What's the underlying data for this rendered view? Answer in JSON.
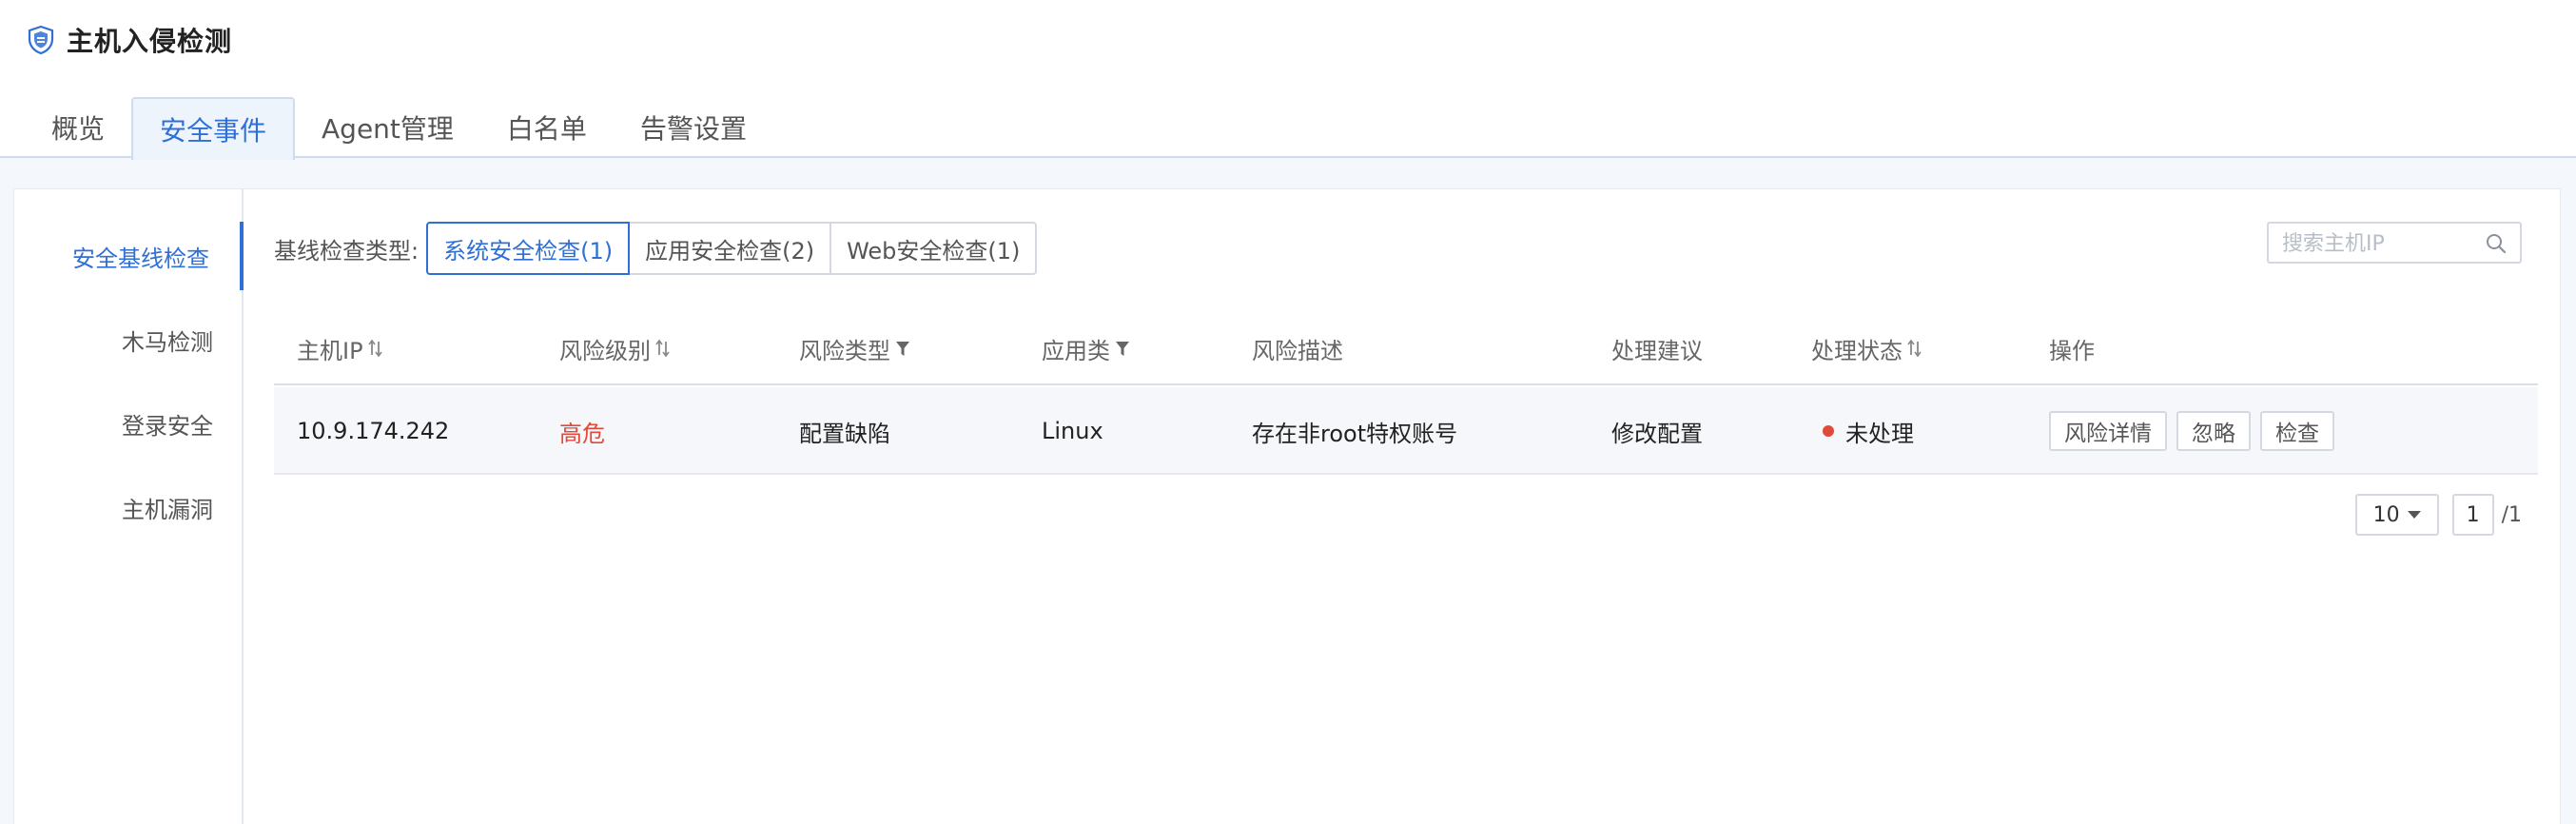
{
  "app": {
    "title": "主机入侵检测"
  },
  "tabs": [
    {
      "label": "概览",
      "active": false
    },
    {
      "label": "安全事件",
      "active": true
    },
    {
      "label": "Agent管理",
      "active": false
    },
    {
      "label": "白名单",
      "active": false
    },
    {
      "label": "告警设置",
      "active": false
    }
  ],
  "sidebar": {
    "items": [
      {
        "label": "安全基线检查",
        "active": true
      },
      {
        "label": "木马检测",
        "active": false
      },
      {
        "label": "登录安全",
        "active": false
      },
      {
        "label": "主机漏洞",
        "active": false
      }
    ]
  },
  "filter": {
    "label": "基线检查类型:",
    "options": [
      {
        "label": "系统安全检查(1)",
        "active": true
      },
      {
        "label": "应用安全检查(2)",
        "active": false
      },
      {
        "label": "Web安全检查(1)",
        "active": false
      }
    ]
  },
  "search": {
    "placeholder": "搜索主机IP",
    "value": ""
  },
  "table": {
    "columns": [
      {
        "label": "主机IP",
        "icon": "sort-icon"
      },
      {
        "label": "风险级别",
        "icon": "sort-icon"
      },
      {
        "label": "风险类型",
        "icon": "filter-icon"
      },
      {
        "label": "应用类",
        "icon": "filter-icon"
      },
      {
        "label": "风险描述",
        "icon": ""
      },
      {
        "label": "处理建议",
        "icon": ""
      },
      {
        "label": "处理状态",
        "icon": "sort-icon"
      },
      {
        "label": "操作",
        "icon": ""
      }
    ],
    "rows": [
      {
        "host_ip": "10.9.174.242",
        "risk_level": "高危",
        "risk_type": "配置缺陷",
        "app_type": "Linux",
        "description": "存在非root特权账号",
        "suggestion": "修改配置",
        "status": "未处理",
        "actions": [
          "风险详情",
          "忽略",
          "检查"
        ]
      }
    ]
  },
  "pagination": {
    "page_size": "10",
    "current_page": "1",
    "total": "/1"
  },
  "colors": {
    "accent": "#2f6fd6",
    "danger": "#e04a3a",
    "border": "#d4d9e1"
  }
}
